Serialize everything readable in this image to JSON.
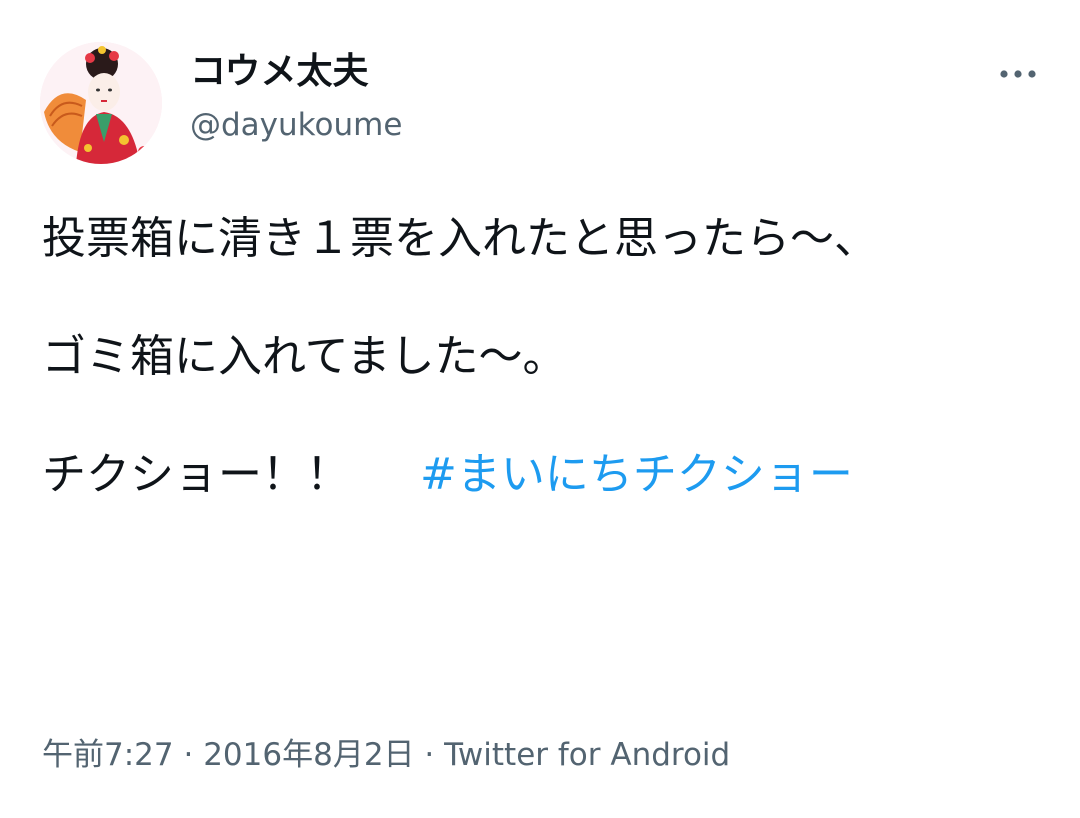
{
  "user": {
    "display_name": "コウメ太夫",
    "handle": "@dayukoume"
  },
  "tweet": {
    "line1": "投票箱に清き１票を入れたと思ったら〜、",
    "line2": "ゴミ箱に入れてました〜。",
    "line3": "チクショー！！",
    "hashtag": "#まいにちチクショー"
  },
  "meta": {
    "time": "午前7:27",
    "separator": "·",
    "date": "2016年8月2日",
    "source": "Twitter for Android"
  },
  "colors": {
    "link": "#1d9bf0",
    "secondary_text": "#536471",
    "primary_text": "#0f1419"
  },
  "icons": {
    "more": "more-horizontal-icon"
  }
}
